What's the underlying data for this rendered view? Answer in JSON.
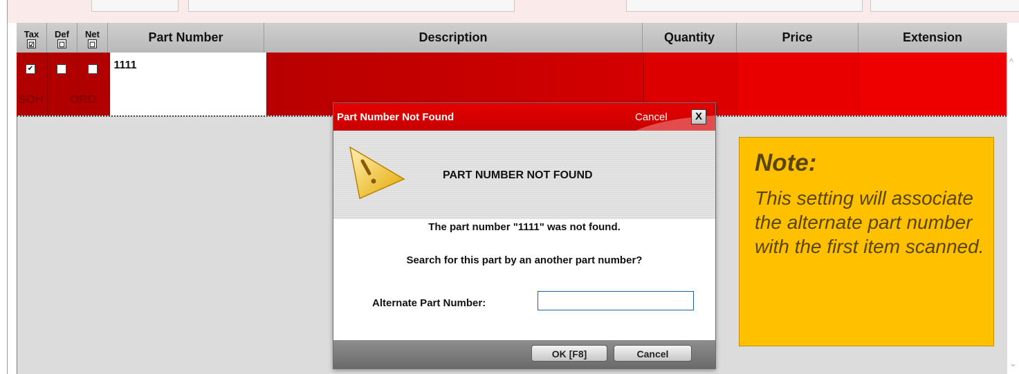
{
  "grid": {
    "headers": {
      "tax": "Tax",
      "def": "Def",
      "net": "Net",
      "part_number": "Part Number",
      "description": "Description",
      "quantity": "Quantity",
      "price": "Price",
      "extension": "Extension"
    },
    "header_checkboxes": {
      "tax": "☑",
      "def": "☐",
      "net": "☐"
    },
    "row": {
      "part_number": "1111",
      "tax_checked": "✔",
      "def_checked": "",
      "net_checked": "",
      "soh": "SOH",
      "ord": "ORD"
    }
  },
  "dialog": {
    "title": "Part Number Not Found",
    "cancel_link": "Cancel",
    "close_glyph": "X",
    "heading": "PART NUMBER NOT FOUND",
    "message1": "The part number \"1111\" was not found.",
    "message2": "Search for this part by an another part number?",
    "alt_label": "Alternate Part Number:",
    "alt_value": "",
    "ok_button": "OK [F8]",
    "cancel_button": "Cancel"
  },
  "note": {
    "title": "Note:",
    "body": "This setting will associate the alternate part number with the first item scanned."
  },
  "colors": {
    "row_red": "#dd0000",
    "dialog_title": "#d40000",
    "note_bg": "#ffc000",
    "note_text": "#594400"
  },
  "icons": {
    "warning": "warning-triangle-icon"
  }
}
